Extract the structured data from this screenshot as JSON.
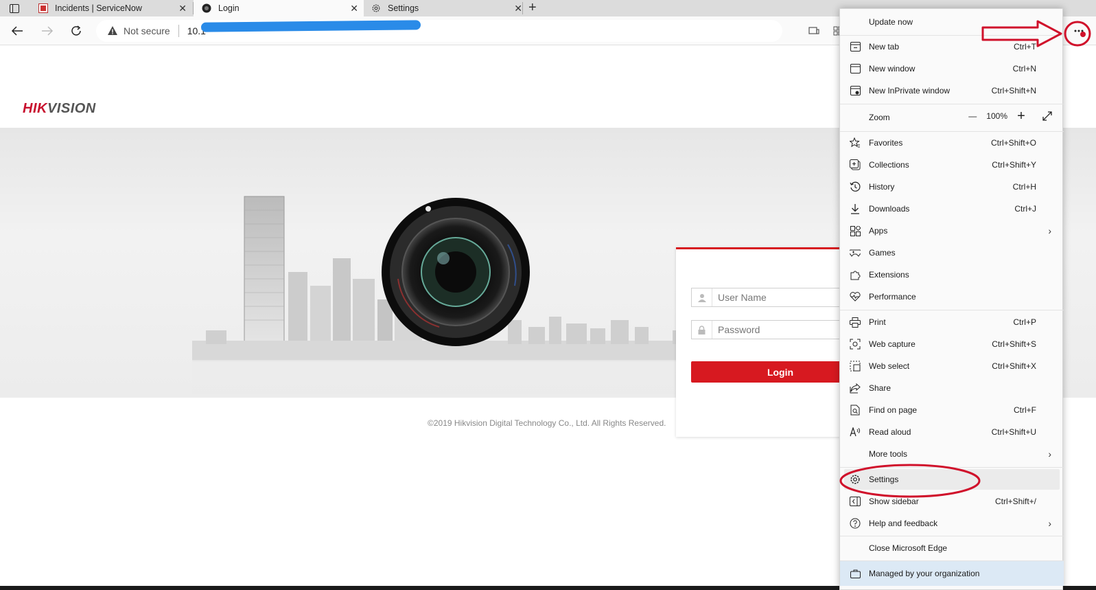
{
  "browser": {
    "tabs": [
      {
        "title": "Incidents | ServiceNow",
        "close": "✕"
      },
      {
        "title": "Login",
        "close": "✕"
      },
      {
        "title": "Settings",
        "close": "✕"
      }
    ],
    "new_tab": "+",
    "address": {
      "security": "Not secure",
      "url": "10.1"
    }
  },
  "page": {
    "logo_part1": "HIK",
    "logo_part2": "VISION",
    "username_placeholder": "User Name",
    "password_placeholder": "Password",
    "login_label": "Login",
    "footer": "©2019 Hikvision Digital Technology Co., Ltd. All Rights Reserved."
  },
  "menu": {
    "update": "Update now",
    "zoom_label": "Zoom",
    "zoom_value": "100%",
    "zoom_minus": "—",
    "zoom_plus": "+",
    "items": [
      {
        "label": "New tab",
        "shortcut": "Ctrl+T",
        "icon": "new-tab-icon"
      },
      {
        "label": "New window",
        "shortcut": "Ctrl+N",
        "icon": "window-icon"
      },
      {
        "label": "New InPrivate window",
        "shortcut": "Ctrl+Shift+N",
        "icon": "inprivate-icon"
      },
      {
        "label": "Favorites",
        "shortcut": "Ctrl+Shift+O",
        "icon": "star-icon"
      },
      {
        "label": "Collections",
        "shortcut": "Ctrl+Shift+Y",
        "icon": "collections-icon"
      },
      {
        "label": "History",
        "shortcut": "Ctrl+H",
        "icon": "history-icon"
      },
      {
        "label": "Downloads",
        "shortcut": "Ctrl+J",
        "icon": "download-icon"
      },
      {
        "label": "Apps",
        "shortcut": "",
        "icon": "apps-icon"
      },
      {
        "label": "Games",
        "shortcut": "",
        "icon": "games-icon"
      },
      {
        "label": "Extensions",
        "shortcut": "",
        "icon": "puzzle-icon"
      },
      {
        "label": "Performance",
        "shortcut": "",
        "icon": "heart-pulse-icon"
      },
      {
        "label": "Print",
        "shortcut": "Ctrl+P",
        "icon": "printer-icon"
      },
      {
        "label": "Web capture",
        "shortcut": "Ctrl+Shift+S",
        "icon": "capture-icon"
      },
      {
        "label": "Web select",
        "shortcut": "Ctrl+Shift+X",
        "icon": "select-icon"
      },
      {
        "label": "Share",
        "shortcut": "",
        "icon": "share-icon"
      },
      {
        "label": "Find on page",
        "shortcut": "Ctrl+F",
        "icon": "find-icon"
      },
      {
        "label": "Read aloud",
        "shortcut": "Ctrl+Shift+U",
        "icon": "read-aloud-icon"
      },
      {
        "label": "More tools",
        "shortcut": "",
        "icon": ""
      },
      {
        "label": "Settings",
        "shortcut": "",
        "icon": "gear-icon"
      },
      {
        "label": "Show sidebar",
        "shortcut": "Ctrl+Shift+/",
        "icon": "sidebar-icon"
      },
      {
        "label": "Help and feedback",
        "shortcut": "",
        "icon": "help-icon"
      },
      {
        "label": "Close Microsoft Edge",
        "shortcut": "",
        "icon": ""
      },
      {
        "label": "Managed by your organization",
        "shortcut": "",
        "icon": "briefcase-icon"
      }
    ]
  },
  "colors": {
    "hik_red": "#d71920",
    "annotation_red": "#d0112b",
    "redaction_blue": "#2a8be8"
  }
}
